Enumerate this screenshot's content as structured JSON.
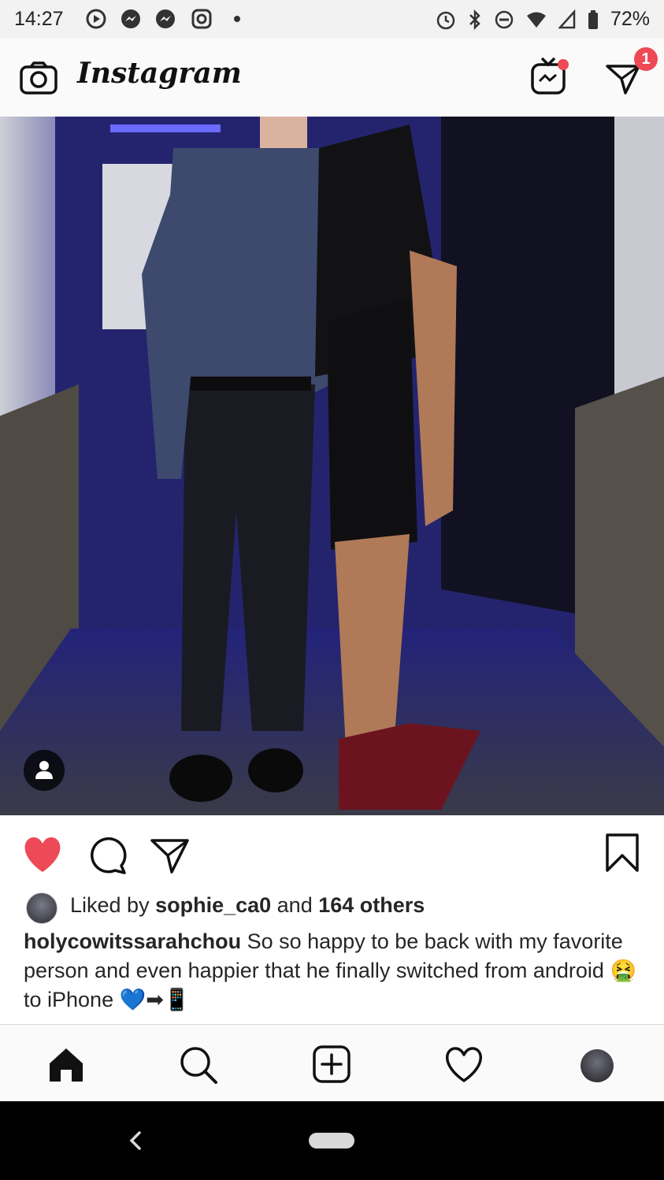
{
  "status_bar": {
    "time": "14:27",
    "battery": "72%",
    "left_icons": [
      "media-player-icon",
      "messenger-icon",
      "messenger-icon",
      "instagram-icon",
      "dot-icon"
    ],
    "right_icons": [
      "alarm-icon",
      "bluetooth-icon",
      "do-not-disturb-icon",
      "wifi-icon",
      "cell-signal-icon",
      "battery-icon"
    ]
  },
  "header": {
    "title": "Instagram",
    "camera_icon": "camera-icon",
    "igtv_icon": "igtv-icon",
    "direct_icon": "direct-message-icon",
    "direct_badge": "1"
  },
  "post": {
    "image_alt": "Photo of a man and a woman standing in a hallway with purple lighting",
    "actions": [
      "heart-icon",
      "comment-icon",
      "share-icon",
      "bookmark-icon"
    ],
    "liked": true,
    "likes_prefix": "Liked by ",
    "likes_user": "sophie_ca0",
    "likes_mid": " and ",
    "likes_count": "164 others",
    "caption_user": "holycowitssarahchou",
    "caption_text": " So so happy to be back with my favorite person and even happier that he finally switched from android 🤮 to iPhone 💙➡📱"
  },
  "bottom_nav": {
    "items": [
      "home-icon",
      "search-icon",
      "new-post-icon",
      "activity-icon",
      "profile-icon"
    ]
  },
  "colors": {
    "heart": "#ed4956",
    "badge": "#ed4956",
    "text": "#262626"
  }
}
